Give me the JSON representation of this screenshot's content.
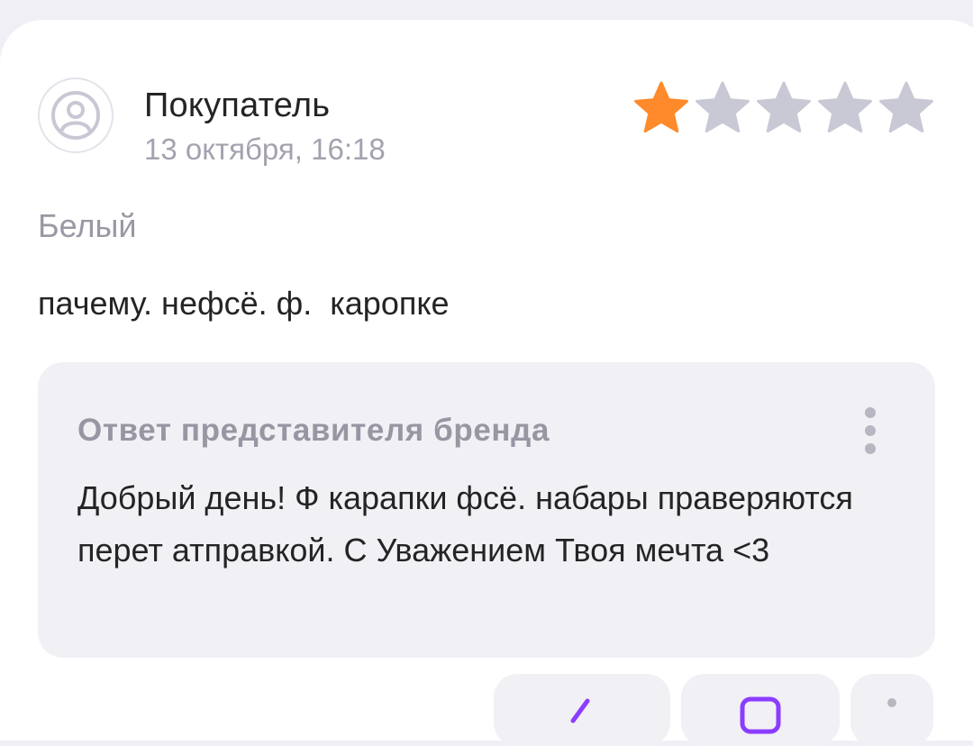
{
  "review": {
    "author": "Покупатель",
    "date": "13 октября, 16:18",
    "rating": 1,
    "rating_max": 5,
    "variant": "Белый",
    "text": "пачему. нефсё. ф.  каропке"
  },
  "reply": {
    "title": "Ответ представителя бренда",
    "text": "Добрый день! Ф карапки фсё. набары праверяются перет атправкой. С Уважением Твоя мечта <3"
  },
  "colors": {
    "star_filled": "#ff8a2b",
    "star_empty": "#c9c8d5",
    "accent_purple": "#8b3dff"
  },
  "icons": {
    "avatar": "user-circle-icon",
    "star": "star-icon",
    "menu": "more-vertical-icon",
    "action_1": "share-icon",
    "action_2": "camera-icon",
    "action_3": "more-vertical-icon"
  }
}
